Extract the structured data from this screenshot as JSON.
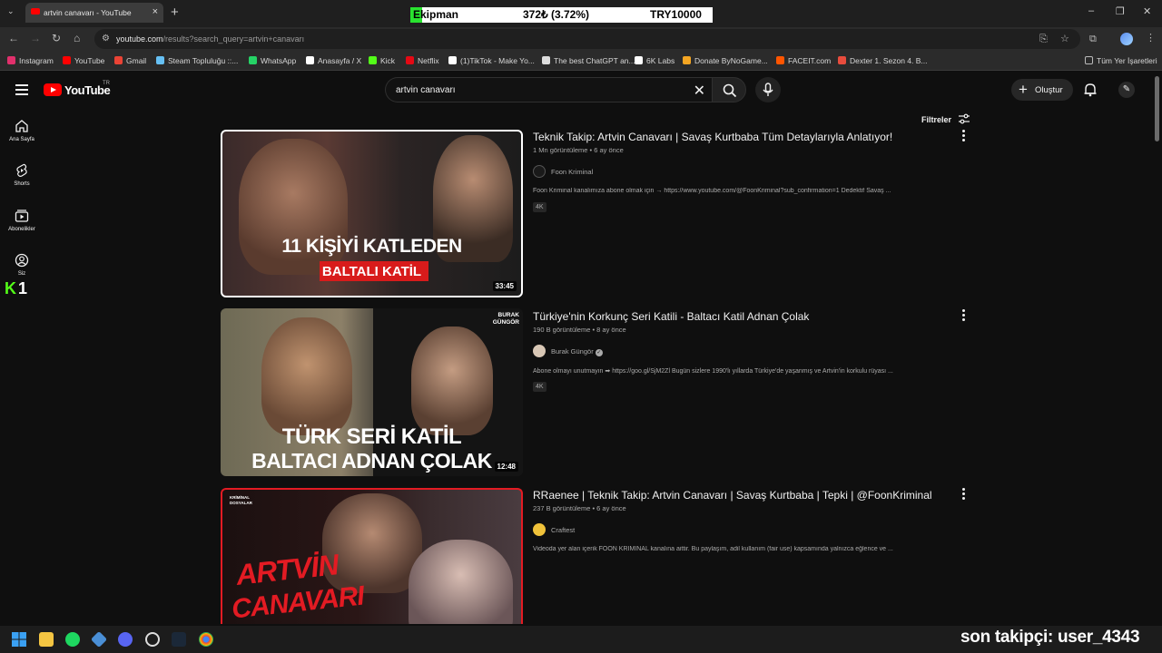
{
  "browser": {
    "tab_title": "artvin canavarı - YouTube",
    "url_host": "youtube.com",
    "url_path": "/results?search_query=artvin+canavarı",
    "bookmarks": [
      {
        "label": "Instagram",
        "color": "#e1306c"
      },
      {
        "label": "YouTube",
        "color": "#ff0000"
      },
      {
        "label": "Gmail",
        "color": "#ea4335"
      },
      {
        "label": "Steam Topluluğu ::...",
        "color": "#66c0f4"
      },
      {
        "label": "WhatsApp",
        "color": "#25d366"
      },
      {
        "label": "Anasayfa / X",
        "color": "#ffffff"
      },
      {
        "label": "Kick",
        "color": "#53fc18"
      },
      {
        "label": "Netflix",
        "color": "#e50914"
      },
      {
        "label": "(1)TikTok - Make Yo...",
        "color": "#ffffff"
      },
      {
        "label": "The best ChatGPT an...",
        "color": "#dddddd"
      },
      {
        "label": "6K Labs",
        "color": "#ffffff"
      },
      {
        "label": "Donate ByNoGame...",
        "color": "#f5a623"
      },
      {
        "label": "FACEIT.com",
        "color": "#ff5500"
      },
      {
        "label": "Dexter 1. Sezon 4. B...",
        "color": "#e84c3d"
      },
      {
        "label": "Tüm Yer İşaretleri",
        "color": "#bbbbbb"
      }
    ]
  },
  "stock_overlay": {
    "name": "Ekipman",
    "change": "372₺ (3.72%)",
    "total": "TRY10000"
  },
  "youtube": {
    "logo_text": "YouTube",
    "country": "TR",
    "search_query": "artvin canavarı",
    "create_label": "Oluştur",
    "filters_label": "Filtreler",
    "rail": [
      {
        "label": "Ana Sayfa"
      },
      {
        "label": "Shorts"
      },
      {
        "label": "Abonelikler"
      },
      {
        "label": "Siz"
      }
    ],
    "results": [
      {
        "title": "Teknik Takip: Artvin Canavarı | Savaş Kurtbaba Tüm Detaylarıyla Anlatıyor!",
        "meta": "1 Mn görüntüleme • 6 ay önce",
        "channel": "Foon Kriminal",
        "description": "Foon Kriminal kanalımıza abone olmak için → https://www.youtube.com/@FoonKriminal?sub_confirmation=1 Dedektif Savaş ...",
        "badge": "4K",
        "duration": "33:45",
        "thumb_line1": "11 KİŞİYİ KATLEDEN",
        "thumb_line2": "BALTALI KATİL"
      },
      {
        "title": "Türkiye'nin Korkunç Seri Katili - Baltacı Katil Adnan Çolak",
        "meta": "190 B görüntüleme • 8 ay önce",
        "channel": "Burak Güngör",
        "description": "Abone olmayı unutmayın ➡ https://goo.gl/SjM2Zl Bugün sizlere 1990'lı yıllarda Türkiye'de yaşanmış ve Artvin'in korkulu rüyası ...",
        "badge": "4K",
        "duration": "12:48",
        "thumb_line1": "TÜRK SERİ KATİL",
        "thumb_line2": "BALTACI ADNAN ÇOLAK",
        "thumb_brand": "BURAK GÜNGÖR"
      },
      {
        "title": "RRaenee | Teknik Takip: Artvin Canavarı | Savaş Kurtbaba | Tepki | @FoonKriminal",
        "meta": "237 B görüntüleme • 6 ay önce",
        "channel": "Craftest",
        "description": "Videoda yer alan içerik FOON KRİMİNAL kanalına aittir. Bu paylaşım, adil kullanım (fair use) kapsamında yalnızca eğlence ve ...",
        "thumb_line1": "ARTVİN",
        "thumb_line2": "CANAVARI",
        "thumb_brand": "KRİMİNAL DOSYALAR"
      }
    ]
  },
  "stream_overlay": {
    "kick_count": "1",
    "follower_text": "son takipçi: user_4343"
  }
}
